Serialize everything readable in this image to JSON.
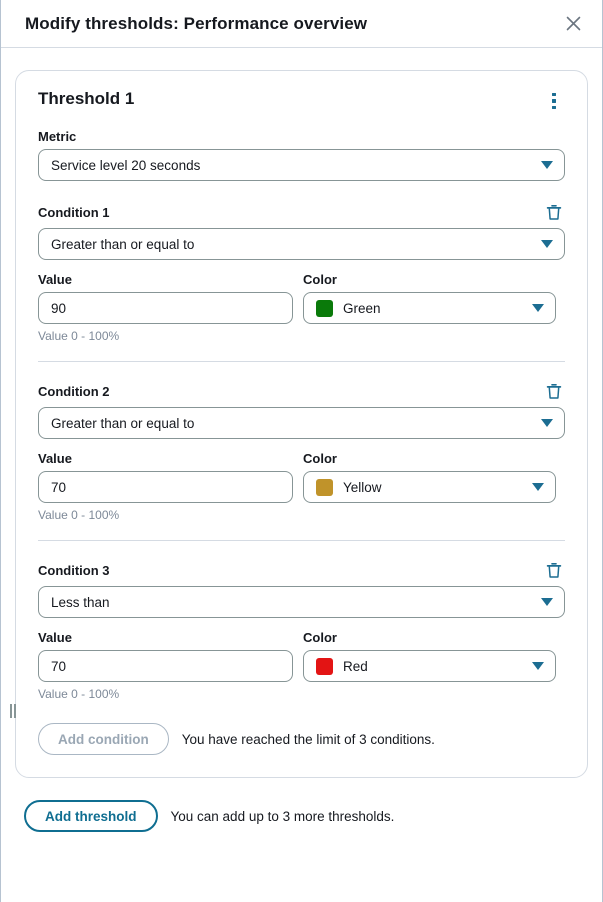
{
  "header": {
    "title": "Modify thresholds: Performance overview",
    "close_icon": "close-icon"
  },
  "drag_handle": {
    "icon": "resize-handle-icon"
  },
  "threshold": {
    "title": "Threshold 1",
    "menu_icon": "kebab-menu-icon",
    "metric": {
      "label": "Metric",
      "value": "Service level 20 seconds"
    },
    "conditions": [
      {
        "label": "Condition 1",
        "delete_icon": "trash-icon",
        "operator": "Greater than or equal to",
        "value_label": "Value",
        "value": "90",
        "value_hint": "Value 0 - 100%",
        "color_label": "Color",
        "color_name": "Green",
        "color_hex": "#0a7a0a"
      },
      {
        "label": "Condition 2",
        "delete_icon": "trash-icon",
        "operator": "Greater than or equal to",
        "value_label": "Value",
        "value": "70",
        "value_hint": "Value 0 - 100%",
        "color_label": "Color",
        "color_name": "Yellow",
        "color_hex": "#c0932a"
      },
      {
        "label": "Condition 3",
        "delete_icon": "trash-icon",
        "operator": "Less than",
        "value_label": "Value",
        "value": "70",
        "value_hint": "Value 0 - 100%",
        "color_label": "Color",
        "color_name": "Red",
        "color_hex": "#e31414"
      }
    ],
    "add_condition": {
      "label": "Add condition",
      "note": "You have reached the limit of 3 conditions.",
      "disabled": true
    }
  },
  "footer": {
    "add_threshold_label": "Add threshold",
    "add_threshold_note": "You can add up to 3 more thresholds."
  },
  "theme": {
    "accent": "#0f6e91",
    "icon_teal": "#1c6d92",
    "border": "#879596",
    "card_border": "#d5dbe3",
    "text": "#16191f",
    "muted": "#7d8998"
  }
}
